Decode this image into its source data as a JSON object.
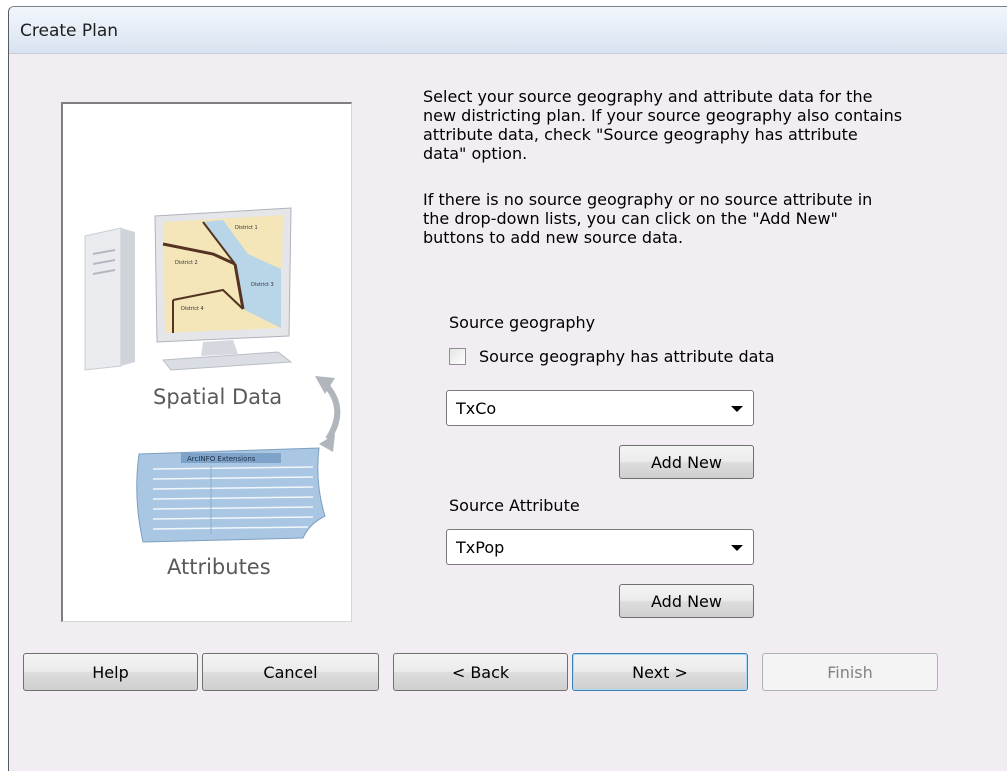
{
  "window": {
    "title": "Create Plan"
  },
  "illustration": {
    "spatial_label": "Spatial Data",
    "attributes_label": "Attributes",
    "map_labels": [
      "District 1",
      "District 2",
      "District 3",
      "District 4"
    ],
    "table_heading": "ArcINFO Extensions"
  },
  "instructions": {
    "paragraph1": "Select your source geography and attribute data for the new districting plan. If your source geography also contains attribute data, check \"Source geography has attribute data\" option.",
    "paragraph2": "If there is no source geography or no source attribute in the drop-down lists, you can click on the \"Add New\" buttons to add new source data."
  },
  "source_geography": {
    "label": "Source geography",
    "checkbox_label": "Source geography has attribute data",
    "checkbox_checked": false,
    "selected": "TxCo",
    "add_new_label": "Add New"
  },
  "source_attribute": {
    "label": "Source Attribute",
    "selected": "TxPop",
    "add_new_label": "Add New"
  },
  "buttons": {
    "help": "Help",
    "cancel": "Cancel",
    "back": "< Back",
    "next": "Next >",
    "finish": "Finish"
  }
}
